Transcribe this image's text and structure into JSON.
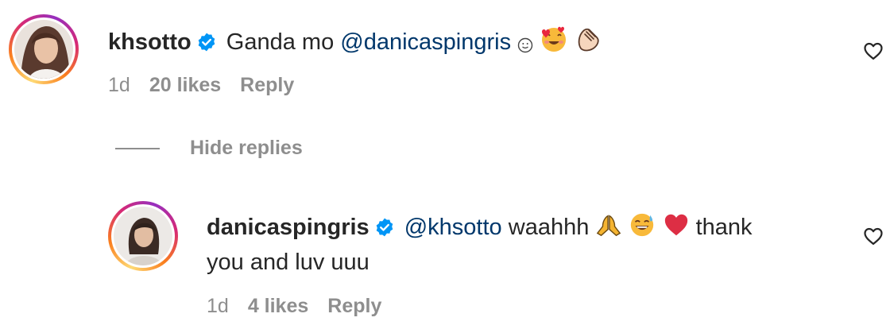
{
  "comments": [
    {
      "username": "khsotto",
      "text_prefix": "Ganda mo",
      "mention": "@danicaspingris",
      "emojis": [
        "smiling-face-emoji",
        "smiling-face-with-hearts-emoji",
        "clapping-hands-emoji"
      ],
      "time": "1d",
      "likes": "20 likes",
      "reply_label": "Reply"
    },
    {
      "username": "danicaspingris",
      "mention": "@khsotto",
      "text_prefix": "waahhh",
      "emojis": [
        "folded-hands-emoji",
        "grinning-sweat-emoji",
        "red-heart-emoji"
      ],
      "text_suffix": "thank",
      "text_line2": "you and luv uuu",
      "time": "1d",
      "likes": "4 likes",
      "reply_label": "Reply"
    }
  ],
  "replies_toggle": {
    "label": "Hide replies"
  },
  "colors": {
    "text": "#262626",
    "meta": "#8e8e8e",
    "mention": "#00376b",
    "verified": "#0095f6"
  }
}
